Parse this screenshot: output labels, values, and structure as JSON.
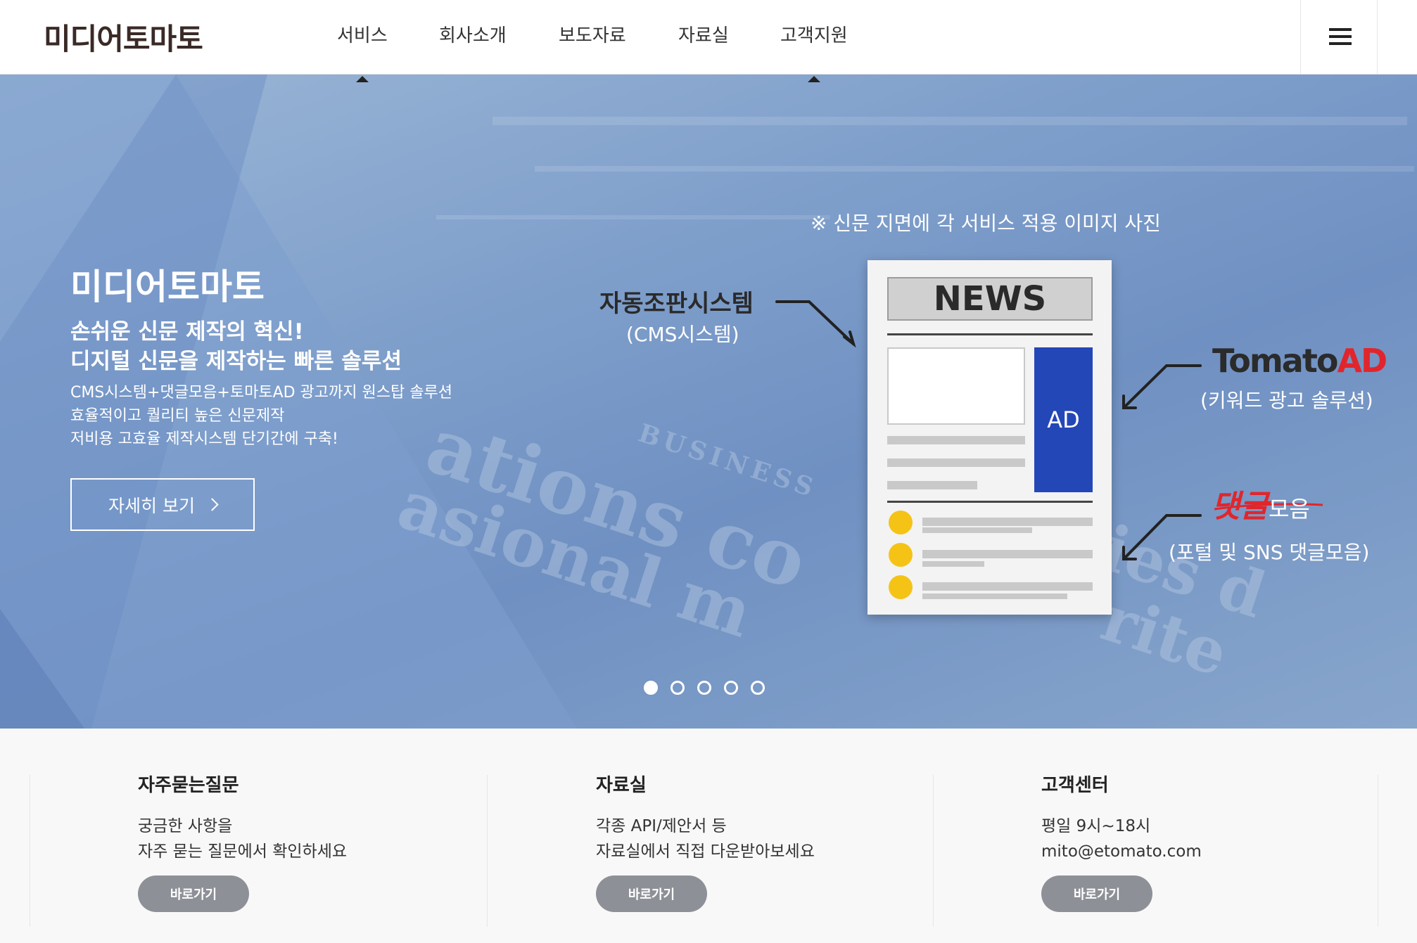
{
  "header": {
    "logo": "미디어토마토",
    "nav": [
      "서비스",
      "회사소개",
      "보도자료",
      "자료실",
      "고객지원"
    ]
  },
  "hero": {
    "title": "미디어토마토",
    "subtitle_lines": [
      "손쉬운 신문 제작의 혁신!",
      "디지털 신문을 제작하는 빠른 솔루션"
    ],
    "desc_lines": [
      "CMS시스템+댓글모음+토마토AD 광고까지 원스탑 솔루션",
      "효율적이고 퀄리티 높은 신문제작",
      "저비용 고효율 제작시스템 단기간에 구축!"
    ],
    "detail_button": "자세히 보기",
    "note": "※ 신문 지면에 각 서비스 적용 이미지 사진",
    "cms_title": "자동조판시스템",
    "cms_sub": "(CMS시스템)",
    "news_label": "NEWS",
    "ad_label": "AD",
    "tomato_ad_1": "Tomato",
    "tomato_ad_2": "AD",
    "tomato_ad_sub": "(키워드 광고 솔루션)",
    "comment_title_1": "댓글",
    "comment_title_2": "모음",
    "comment_sub": "(포털 및 SNS 댓글모음)",
    "background_words": [
      "BUSINESS",
      "ations co",
      "asional m",
      "ies d",
      "rite"
    ],
    "slides": 5,
    "active_slide": 1
  },
  "cards": [
    {
      "title": "자주묻는질문",
      "lines": [
        "궁금한 사항을",
        "자주 묻는 질문에서 확인하세요"
      ],
      "button": "바로가기"
    },
    {
      "title": "자료실",
      "lines": [
        "각종 API/제안서 등",
        "자료실에서 직접 다운받아보세요"
      ],
      "button": "바로가기"
    },
    {
      "title": "고객센터",
      "lines": [
        "평일 9시~18시",
        "mito@etomato.com"
      ],
      "button": "바로가기"
    }
  ],
  "colors": {
    "ad_blue": "#2447b8",
    "tomato_red": "#e0262c",
    "button_gray": "#8e9097"
  }
}
